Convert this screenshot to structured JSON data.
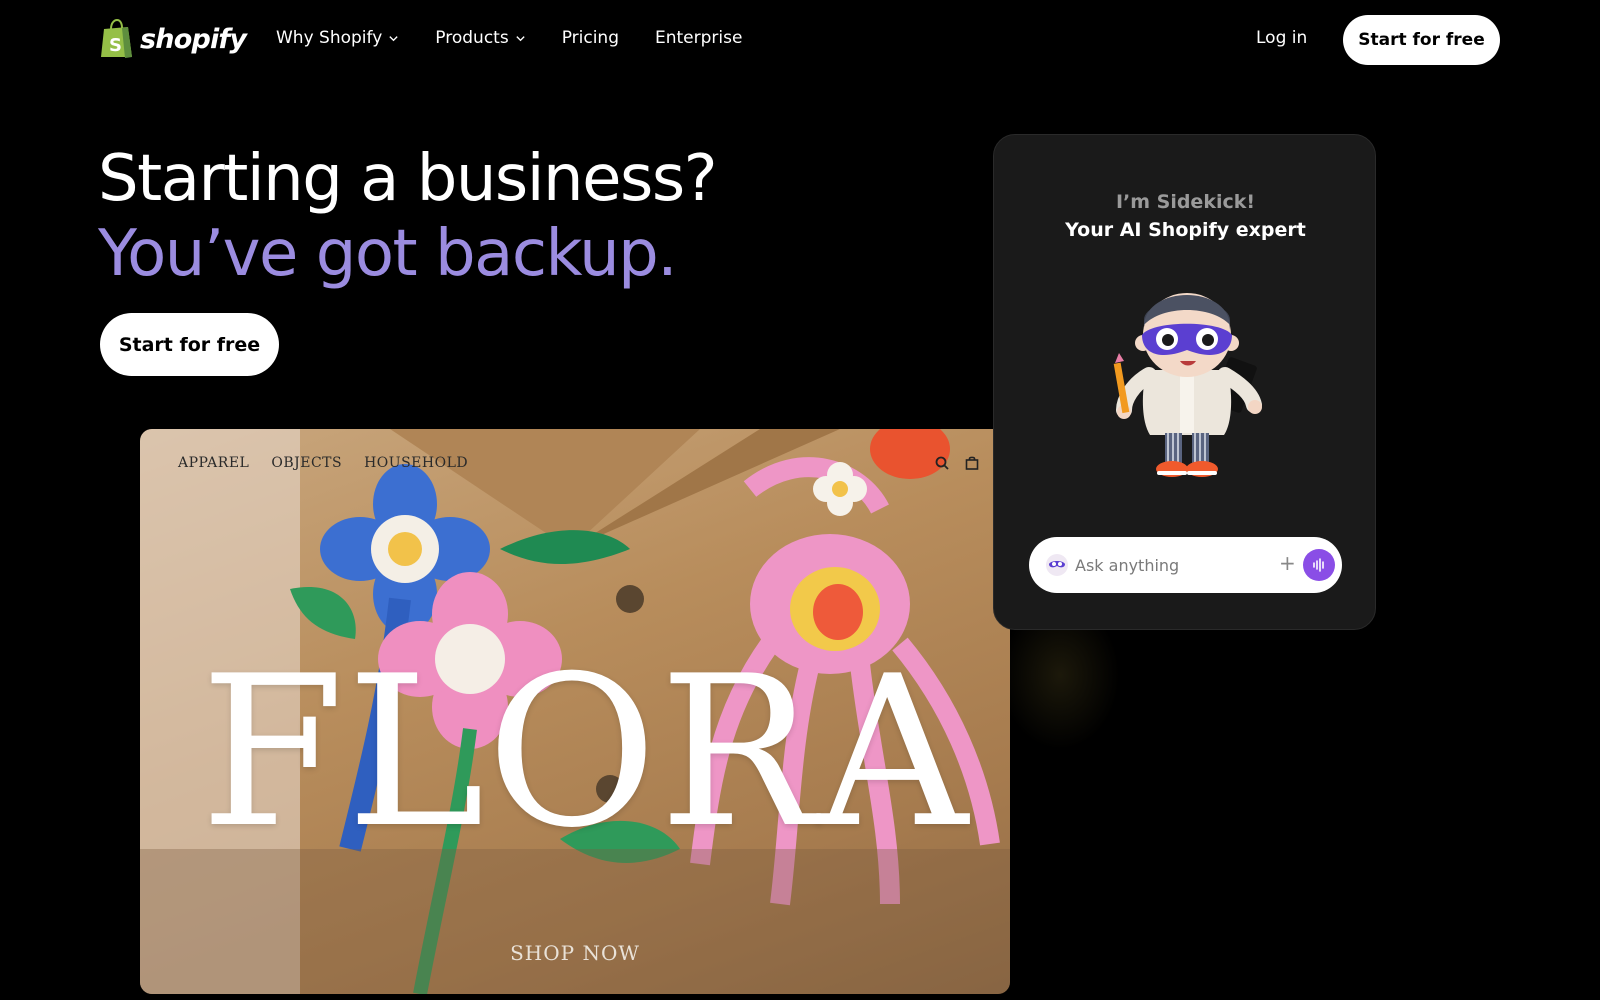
{
  "nav": {
    "logo_text": "shopify",
    "links": [
      {
        "label": "Why Shopify",
        "has_dropdown": true
      },
      {
        "label": "Products",
        "has_dropdown": true
      },
      {
        "label": "Pricing",
        "has_dropdown": false
      },
      {
        "label": "Enterprise",
        "has_dropdown": false
      }
    ],
    "login_label": "Log in",
    "cta_label": "Start for free"
  },
  "hero": {
    "line1": "Starting a business?",
    "line2": "You’ve got backup.",
    "cta_label": "Start for free",
    "line2_color": "#9b8ce0"
  },
  "store_preview": {
    "nav_items": [
      "APPAREL",
      "OBJECTS",
      "HOUSEHOLD"
    ],
    "icons": [
      "search-icon",
      "bag-icon"
    ],
    "brand": "FLORA",
    "cta": "SHOP NOW"
  },
  "sidekick": {
    "title": "I’m Sidekick!",
    "subtitle": "Your AI Shopify expert",
    "input_placeholder": "Ask anything",
    "plus_symbol": "+",
    "accent_color": "#8a4ee6"
  }
}
